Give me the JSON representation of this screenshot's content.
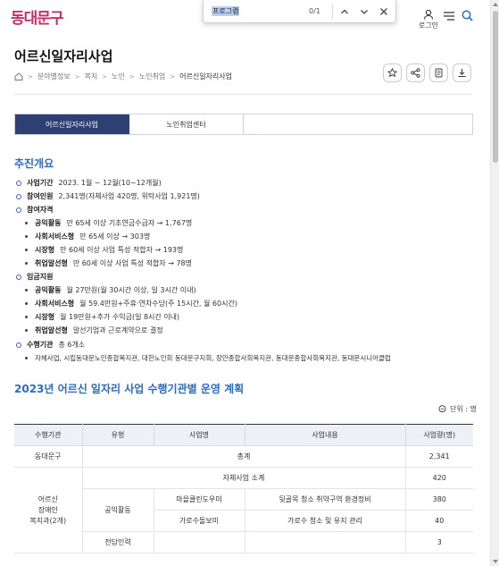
{
  "header": {
    "logo": "동대문구",
    "login_label": "로그인"
  },
  "findbar": {
    "query": "프로그램",
    "count": "0/1"
  },
  "page": {
    "title": "어르신일자리사업",
    "breadcrumb": [
      "분야별정보",
      "복지",
      "노인",
      "노인취업",
      "어르신일자리사업"
    ]
  },
  "tabs": [
    {
      "label": "어르신일자리사업",
      "active": true
    },
    {
      "label": "노인취업센터",
      "active": false
    }
  ],
  "section1": {
    "title": "추진개요",
    "period_key": "사업기간",
    "period_val": "2023. 1월 ~ 12월(10~12개월)",
    "people_key": "참여인원",
    "people_val": "2,341명(자체사업 420명, 위탁사업 1,921명)",
    "qual_key": "참여자격",
    "qual": [
      {
        "k": "공익활동",
        "v": "만 65세 이상 기초연금수급자 → 1,767명"
      },
      {
        "k": "사회서비스형",
        "v": "만 65세 이상 → 303명"
      },
      {
        "k": "시장형",
        "v": "만 60세 이상 사업 특성 적합자 → 193명"
      },
      {
        "k": "취업알선형",
        "v": "만 60세 이상 사업 특성 적합자 → 78명"
      }
    ],
    "wage_key": "임금지원",
    "wage": [
      {
        "k": "공익활동",
        "v": "월 27만원(월 30시간 이상, 일 3시간 이내)"
      },
      {
        "k": "사회서비스형",
        "v": "월 59.4만원+주휴·연차수당(주 15시간, 월 60시간)"
      },
      {
        "k": "시장형",
        "v": "월 19만원+추가 수익금(일 8시간 이내)"
      },
      {
        "k": "취업알선형",
        "v": "알선기업과 근로계약으로 결정"
      }
    ],
    "org_key": "수행기관",
    "org_val": "총 6개소",
    "org_list": "자체사업, 시립동대문노인종합복지관, 대한노인회 동대문구지회, 장안종합사회복지관, 동대문종합사회복지관, 동대문시니어클럽"
  },
  "section2": {
    "title": "2023년 어르신 일자리 사업 수행기관별 운영 계획",
    "unit": "단위 : 명"
  },
  "table": {
    "headers": [
      "수행기관",
      "유형",
      "사업명",
      "사업내용",
      "사업량(명)"
    ],
    "total_org": "동대문구",
    "total_label": "총계",
    "total_val": "2,341",
    "self_label": "자체사업 소계",
    "self_val": "420",
    "org_name": "어르신\n장애인\n복지과(2개)",
    "type_public": "공익활동",
    "r1_name": "마을클린도우미",
    "r1_desc": "뒷골목 청소 취약구역 환경정비",
    "r1_val": "380",
    "r2_name": "가로수돌보미",
    "r2_desc": "가로수 청소 및 유지 관리",
    "r2_val": "40",
    "type_staff": "전담인력",
    "r3_val": "3"
  },
  "colors": {
    "accent": "#2a6cc4",
    "tab_active": "#2d3f73",
    "logo": "#c4306a"
  }
}
